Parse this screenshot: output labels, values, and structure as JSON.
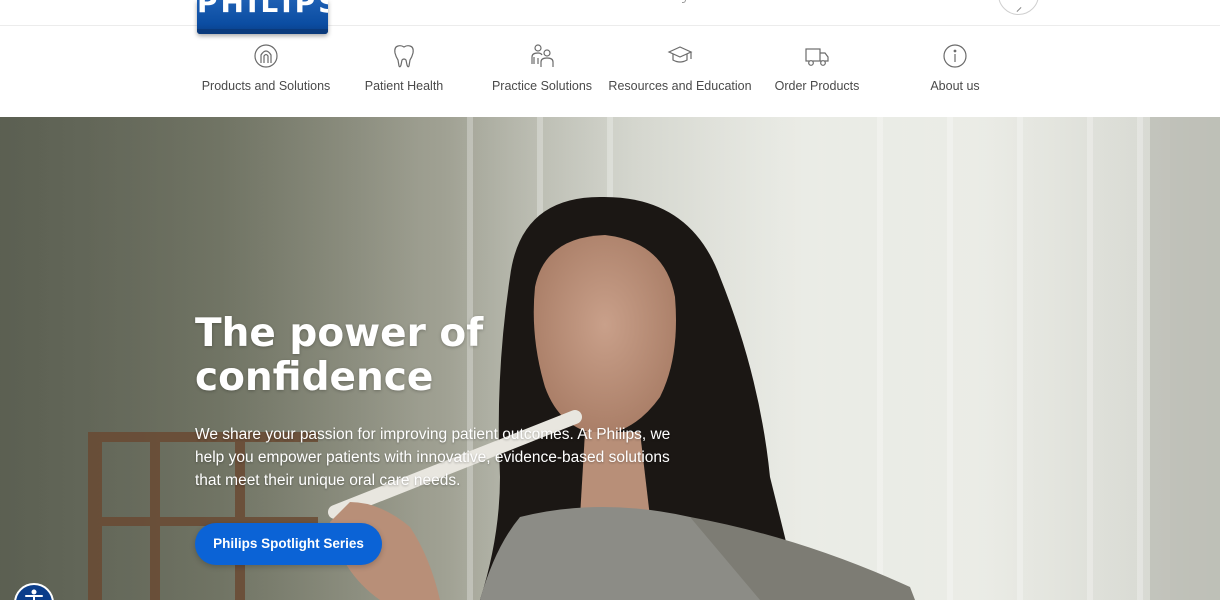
{
  "brand": {
    "logo_text": "PHILIPS"
  },
  "nav": {
    "items": [
      {
        "label": "Products and Solutions",
        "icon": "product-icon"
      },
      {
        "label": "Patient Health",
        "icon": "tooth-icon"
      },
      {
        "label": "Practice Solutions",
        "icon": "team-icon"
      },
      {
        "label": "Resources and Education",
        "icon": "graduation-cap-icon"
      },
      {
        "label": "Order Products",
        "icon": "delivery-truck-icon"
      },
      {
        "label": "About us",
        "icon": "info-icon"
      }
    ]
  },
  "hero": {
    "title_line1": "The power of",
    "title_line2": "confidence",
    "body": "We share your passion for improving patient outcomes. At Philips, we help you empower patients with innovative, evidence-based solutions that meet their unique oral care needs.",
    "cta_label": "Philips Spotlight Series"
  },
  "colors": {
    "brand_blue": "#0b4da2",
    "cta_blue": "#0b63d6",
    "accessibility_blue": "#0b3d8a",
    "icon_gray": "#6b6b6b"
  }
}
